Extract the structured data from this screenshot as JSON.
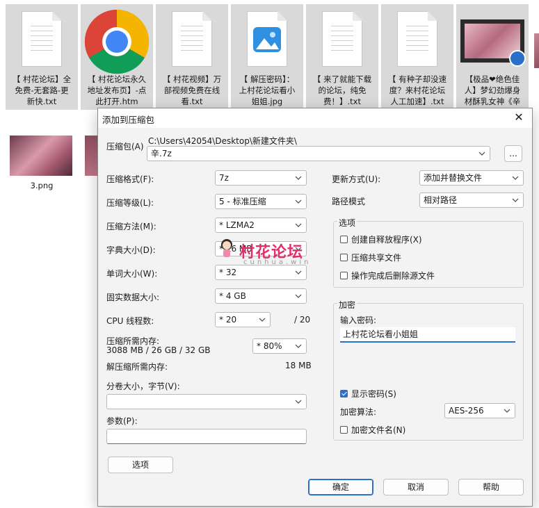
{
  "desktop": {
    "files": [
      {
        "name": "【村花论坛】全免费-无套路-更新快.txt",
        "label": "【 村花论坛】全\n免费-无套路-更\n新快.txt",
        "type": "txt"
      },
      {
        "name": "【村花论坛永久地址发布页】-点此打开.htm",
        "label": "【 村花论坛永久\n地址发布页】-点\n此打开.htm",
        "type": "chrome"
      },
      {
        "name": "【村花视频】万部视频免费在线看.txt",
        "label": "【 村花视频】万\n部视频免费在线\n看.txt",
        "type": "txt"
      },
      {
        "name": "【解压密码】：上村花论坛看小姐姐.jpg",
        "label": "【 解压密码】：\n上村花论坛看小\n姐姐.jpg",
        "type": "jpg"
      },
      {
        "name": "【来了就能下载的论坛，纯免费！】.txt",
        "label": "【 来了就能下载\n的论坛，纯免\n费！】.txt",
        "type": "txt"
      },
      {
        "name": "【有种子却没速度？来村花论坛人工加速】.txt",
        "label": "【 有种子却没速\n度？来村花论坛\n人工加速】.txt",
        "type": "txt"
      },
      {
        "name": "【极品❤绝色佳人】梦幻劲爆身材酥乳女神《辛",
        "label": "【极品❤绝色佳\n人】梦幻劲爆身\n材酥乳女神《辛",
        "type": "video"
      }
    ],
    "second_row": [
      {
        "label": "3.png"
      }
    ]
  },
  "dialog": {
    "title": "添加到压缩包",
    "archive_label": "压缩包(A)",
    "archive_path": "C:\\Users\\42054\\Desktop\\新建文件夹\\",
    "archive_name": "辛.7z",
    "browse_label": "...",
    "format_label": "压缩格式(F):",
    "format_value": "7z",
    "level_label": "压缩等级(L):",
    "level_value": "5 - 标准压缩",
    "method_label": "压缩方法(M):",
    "method_value": "* LZMA2",
    "dict_label": "字典大小(D):",
    "dict_value": "* 16 MB",
    "word_label": "单词大小(W):",
    "word_value": "* 32",
    "solid_label": "固实数据大小:",
    "solid_value": "* 4 GB",
    "cpu_label": "CPU 线程数:",
    "cpu_value": "* 20",
    "cpu_total": "/ 20",
    "mem_comp_label": "压缩所需内存:",
    "mem_comp_detail": "3088 MB / 26 GB / 32 GB",
    "mem_comp_value": "* 80%",
    "mem_decomp_label": "解压缩所需内存:",
    "mem_decomp_value": "18 MB",
    "split_label": "分卷大小，字节(V):",
    "split_value": "",
    "params_label": "参数(P):",
    "params_value": "",
    "options_button": "选项",
    "update_label": "更新方式(U):",
    "update_value": "添加并替换文件",
    "path_label": "路径模式",
    "path_value": "相对路径",
    "options_group": "选项",
    "opt_sfx": "创建自释放程序(X)",
    "opt_shared": "压缩共享文件",
    "opt_delete": "操作完成后删除源文件",
    "encryption_group": "加密",
    "password_label": "输入密码:",
    "password_value": "上村花论坛看小姐姐",
    "show_password": "显示密码(S)",
    "enc_method_label": "加密算法:",
    "enc_method_value": "AES-256",
    "enc_names": "加密文件名(N)",
    "ok": "确定",
    "cancel": "取消",
    "help": "帮助",
    "close_glyph": "✕"
  },
  "watermark": {
    "text": "村花论坛",
    "sub": "cunhua.win"
  },
  "colors": {
    "accent": "#2a6fc9",
    "watermark": "#e0306a",
    "selection_bg": "#d9d9d9"
  }
}
